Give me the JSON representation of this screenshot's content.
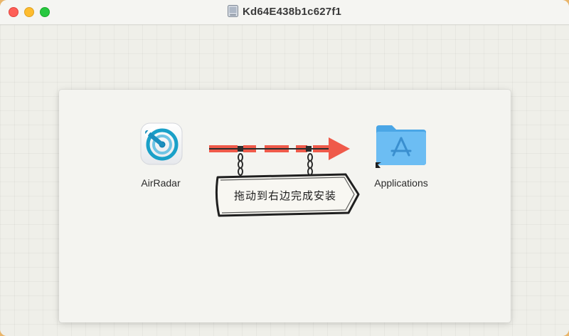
{
  "window": {
    "title": "Kd64E438b1c627f1",
    "controls": [
      "close",
      "minimize",
      "maximize"
    ]
  },
  "installer": {
    "app_label": "AirRadar",
    "app_icon": "airradar-radar-icon",
    "target_label": "Applications",
    "target_icon": "applications-folder-icon",
    "instruction": "拖动到右边完成安装"
  },
  "colors": {
    "close": "#fe5f57",
    "minimize": "#febc2e",
    "maximize": "#28c840",
    "arrow": "#ef5a4a",
    "folder": "#5fb4f0"
  }
}
